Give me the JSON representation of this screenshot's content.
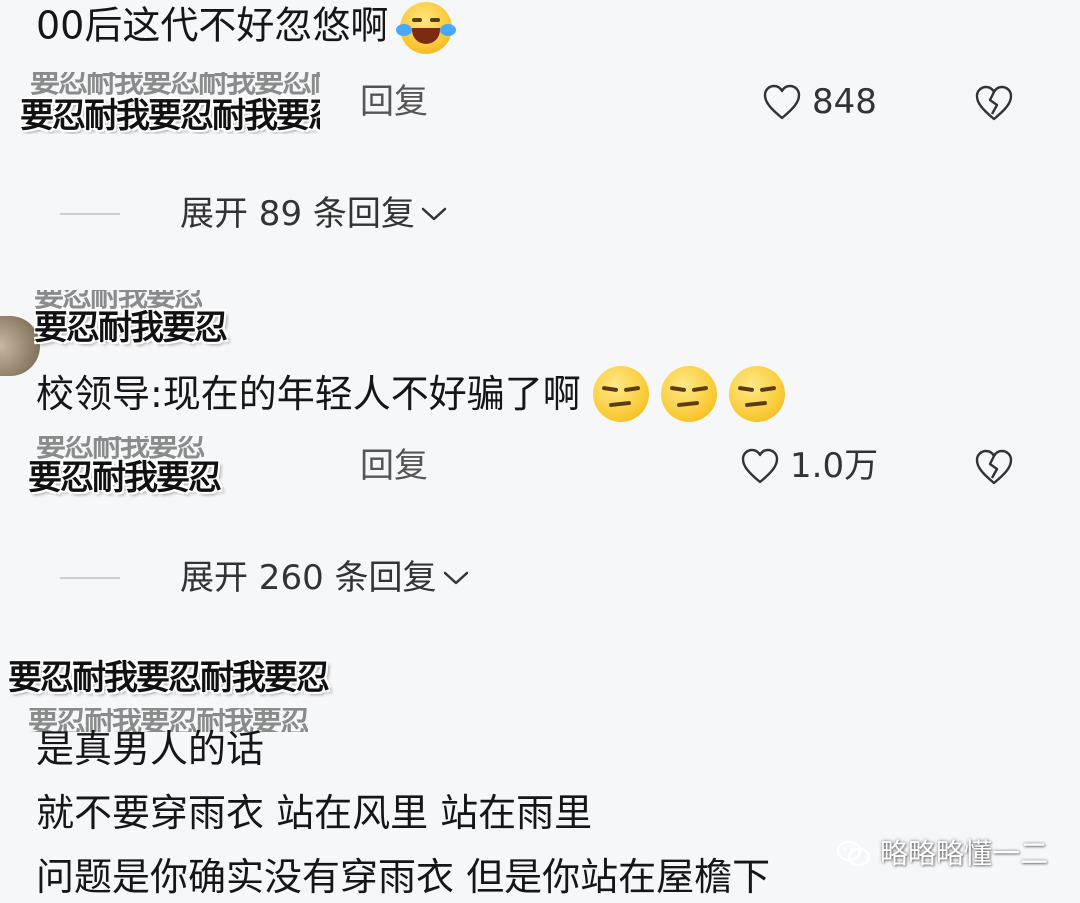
{
  "comments": [
    {
      "username": "要忍耐我要忍耐我要忍耐",
      "text": "00后这代不好忽悠啊",
      "emoji": "laughing-tears-emoji",
      "reply_label": "回复",
      "likes": "848",
      "expand_label": "展开 89 条回复"
    },
    {
      "username": "要忍耐我要忍",
      "text": "校领导:现在的年轻人不好骗了啊",
      "emoji": "smirk-emoji",
      "reply_label": "回复",
      "likes": "1.0万",
      "expand_label": "展开 260 条回复"
    },
    {
      "username": "要忍耐我要忍耐我要忍",
      "text_lines": [
        "是真男人的话",
        "就不要穿雨衣 站在风里 站在雨里",
        "问题是你确实没有穿雨衣 但是你站在屋檐下"
      ]
    }
  ],
  "watermark": {
    "text": "略略略懂一二",
    "icon": "wechat-icon"
  },
  "colors": {
    "background": "#f6f7f9",
    "text": "#161616",
    "secondary": "#555555"
  }
}
